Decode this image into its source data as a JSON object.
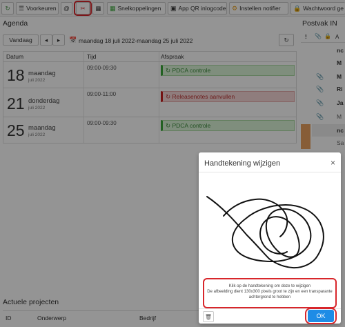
{
  "toolbar": {
    "refresh_icon": "refresh-icon",
    "preferences_label": "Voorkeuren",
    "shortcuts_label": "Snelkoppelingen",
    "qr_label": "App QR inlogcode",
    "notifier_label": "Instellen notifier",
    "password_label": "Wachtwoord ge"
  },
  "agenda": {
    "title": "Agenda",
    "today_label": "Vandaag",
    "date_range": "maandag 18 juli 2022-maandag 25 juli 2022",
    "columns": [
      "Datum",
      "Tijd",
      "Afspraak"
    ],
    "rows": [
      {
        "day": "18",
        "weekday": "maandag",
        "date": "juli 2022",
        "time": "09:00-09:30",
        "appointment": "PDCA controle",
        "status": "green"
      },
      {
        "day": "21",
        "weekday": "donderdag",
        "date": "juli 2022",
        "time": "09:00-11:00",
        "appointment": "Releasenotes aanvullen",
        "status": "red"
      },
      {
        "day": "25",
        "weekday": "maandag",
        "date": "juli 2022",
        "time": "09:00-09:30",
        "appointment": "PDCA controle",
        "status": "green"
      }
    ]
  },
  "postvak": {
    "title": "Postvak IN",
    "header_icons": [
      "!",
      "paperclip-icon",
      "lock-icon",
      "A"
    ],
    "rows": [
      "nc",
      "M",
      "M",
      "Ri",
      "Ja",
      "M",
      "nc",
      "Sa"
    ]
  },
  "projects": {
    "title": "Actuele projecten",
    "columns": [
      "ID",
      "Onderwerp",
      "Bedrijf"
    ]
  },
  "modal": {
    "title": "Handtekening wijzigen",
    "close": "×",
    "info_line1": "Klik op de handtekening om deze te wijzigen",
    "info_line2": "De afbeelding dient 130x300 pixels groot te zijn en een transparante",
    "info_line3": "achtergrond te hebben",
    "ok_label": "OK"
  },
  "colors": {
    "accent_blue": "#1e8ce6",
    "highlight_red": "#d8262b",
    "green_event": "#3aa83a",
    "red_event": "#c81e1e"
  }
}
